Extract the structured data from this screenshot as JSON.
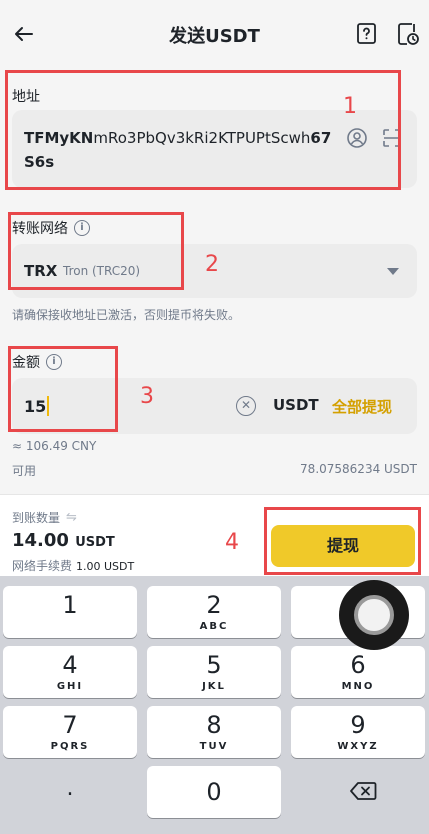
{
  "header": {
    "title": "发送USDT",
    "back_icon": "arrow-left-icon",
    "help_icon": "question-square-icon",
    "history_icon": "document-clock-icon"
  },
  "address": {
    "label": "地址",
    "value_bold_start": "TFMyKN",
    "value_rest": "mRo3PbQv3kRi2KTPUPtScwh",
    "value_bold_end": "67S6s",
    "contact_icon": "address-book-icon",
    "scan_icon": "scan-icon"
  },
  "network": {
    "label": "转账网络",
    "name": "TRX",
    "description": "Tron (TRC20)",
    "hint": "请确保接收地址已激活，否则提币将失败。"
  },
  "amount": {
    "label": "金额",
    "value": "15",
    "unit": "USDT",
    "max_label": "全部提现",
    "cny_estimate": "≈ 106.49 CNY",
    "available_label": "可用",
    "available_value": "78.07586234 USDT"
  },
  "summary": {
    "receive_label": "到账数量",
    "receive_value": "14.00",
    "receive_unit": "USDT",
    "fee_label": "网络手续费",
    "fee_value": "1.00 USDT",
    "withdraw_button": "提现"
  },
  "keyboard": {
    "keys": [
      {
        "num": "1",
        "letters": ""
      },
      {
        "num": "2",
        "letters": "ABC"
      },
      {
        "num": "3",
        "letters": "DEF"
      },
      {
        "num": "4",
        "letters": "GHI"
      },
      {
        "num": "5",
        "letters": "JKL"
      },
      {
        "num": "6",
        "letters": "MNO"
      },
      {
        "num": "7",
        "letters": "PQRS"
      },
      {
        "num": "8",
        "letters": "TUV"
      },
      {
        "num": "9",
        "letters": "WXYZ"
      }
    ],
    "dot": ".",
    "zero": "0",
    "backspace_icon": "backspace-icon"
  },
  "annotations": [
    "1",
    "2",
    "3",
    "4"
  ],
  "colors": {
    "accent": "#f0c929",
    "annotation": "#e8474a",
    "max_text": "#d4a000"
  }
}
